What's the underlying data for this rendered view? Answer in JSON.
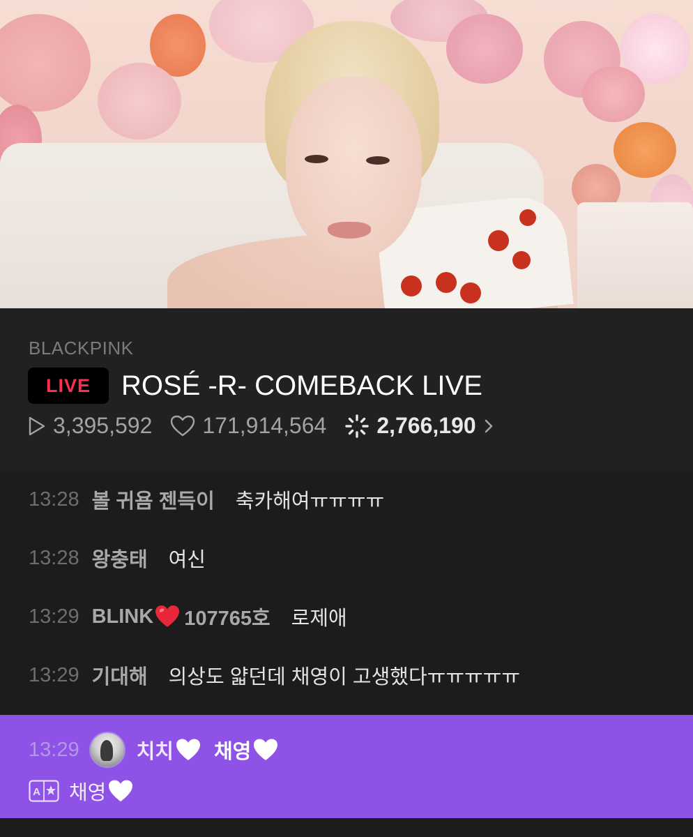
{
  "stream": {
    "channel": "BLACKPINK",
    "live_badge": "LIVE",
    "title": "ROSÉ -R- COMEBACK LIVE",
    "plays": "3,395,592",
    "likes": "171,914,564",
    "viewers": "2,766,190"
  },
  "chat": {
    "messages": [
      {
        "time": "13:28",
        "user": "볼 귀욤 젠득이",
        "text": "축카해여ㅠㅠㅠㅠ"
      },
      {
        "time": "13:28",
        "user": "왕충태",
        "text": "여신"
      },
      {
        "time": "13:29",
        "user_prefix": "BLINK",
        "user_suffix": "107765호",
        "text": "로제애"
      },
      {
        "time": "13:29",
        "user": "기대해",
        "text": "의상도 얇던데 채영이 고생했다ㅠㅠㅠㅠㅠ"
      }
    ],
    "highlighted": {
      "time": "13:29",
      "user": "치치",
      "text": "채영",
      "translation": "채영"
    }
  },
  "colors": {
    "live_red": "#ff2e4d",
    "highlight_purple": "#8e52e6",
    "background": "#1c1c1c"
  },
  "icons": [
    "play-icon",
    "heart-outline-icon",
    "viewers-spinner-icon",
    "chevron-right-icon",
    "red-heart-icon",
    "white-heart-icon",
    "translate-icon",
    "avatar"
  ]
}
